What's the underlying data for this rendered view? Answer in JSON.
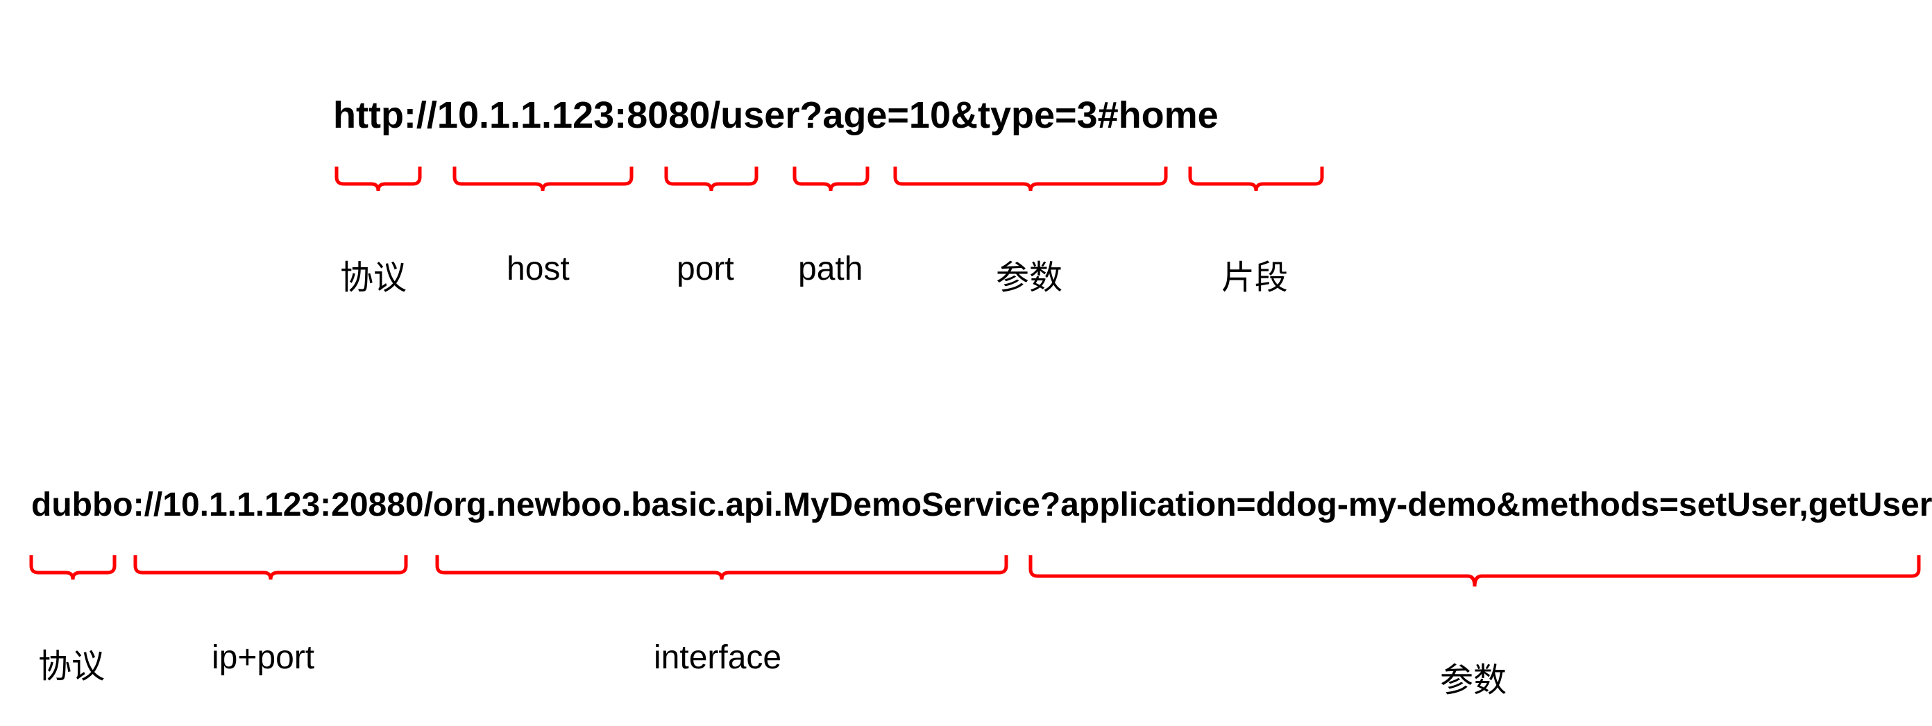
{
  "diagram": {
    "http_url": "http://10.1.1.123:8080/user?age=10&type=3#home",
    "http_labels": {
      "protocol": "协议",
      "host": "host",
      "port": "port",
      "path": "path",
      "params": "参数",
      "fragment": "片段"
    },
    "dubbo_url": "dubbo://10.1.1.123:20880/org.newboo.basic.api.MyDemoService?application=ddog-my-demo&methods=setUser,getUser…",
    "dubbo_labels": {
      "protocol": "协议",
      "ipport": "ip+port",
      "interface": "interface",
      "params": "参数"
    },
    "colors": {
      "brace": "#FF0000",
      "text": "#000000"
    }
  }
}
